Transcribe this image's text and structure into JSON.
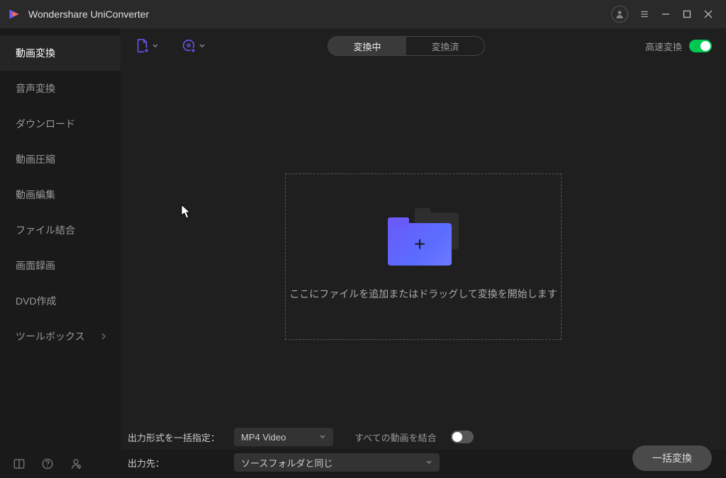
{
  "app": {
    "title": "Wondershare UniConverter"
  },
  "sidebar": {
    "items": [
      {
        "label": "動画変換"
      },
      {
        "label": "音声変換"
      },
      {
        "label": "ダウンロード"
      },
      {
        "label": "動画圧縮"
      },
      {
        "label": "動画編集"
      },
      {
        "label": "ファイル結合"
      },
      {
        "label": "画面録画"
      },
      {
        "label": "DVD作成"
      },
      {
        "label": "ツールボックス"
      }
    ]
  },
  "toolbar": {
    "tabs": {
      "converting": "変換中",
      "converted": "変換済"
    },
    "fast_label": "高速変換"
  },
  "dropzone": {
    "hint": "ここにファイルを追加またはドラッグして変換を開始します"
  },
  "bottom": {
    "output_format_label": "出力形式を一括指定：",
    "output_format_value": "MP4 Video",
    "merge_label": "すべての動画を結合",
    "output_dest_label": "出力先：",
    "output_dest_value": "ソースフォルダと同じ",
    "convert_btn": "一括変換"
  }
}
